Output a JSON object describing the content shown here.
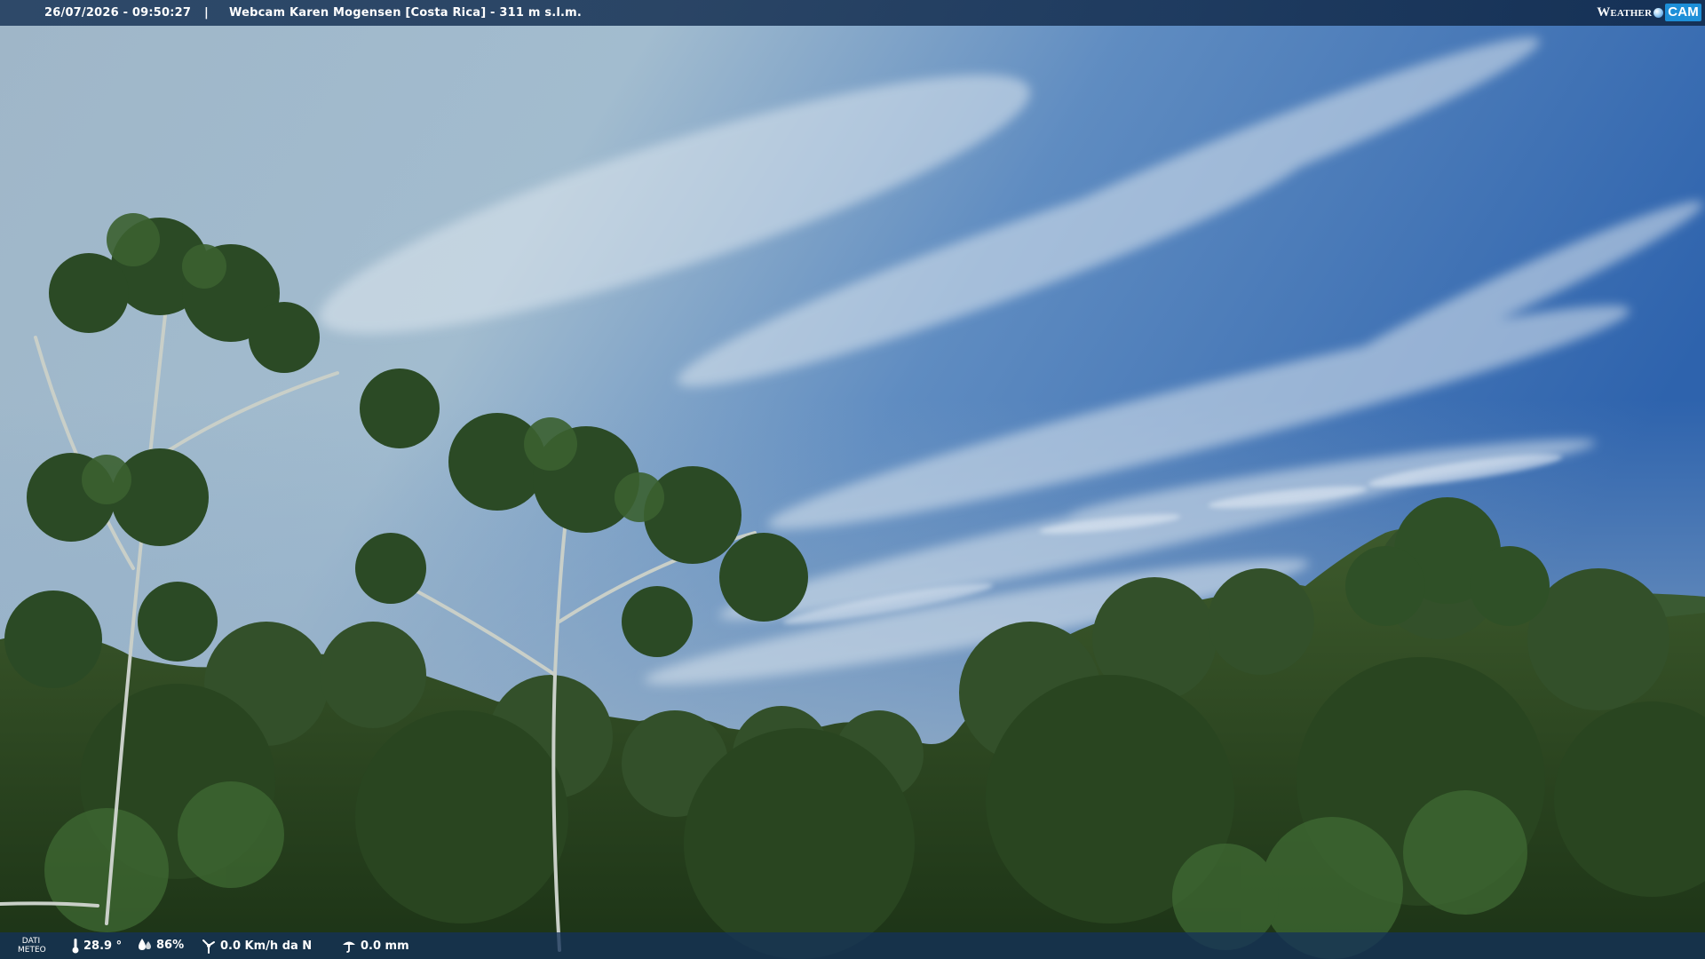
{
  "overlay": {
    "datetime": "26/07/2026 - 09:50:27",
    "separator": "|",
    "title": "Webcam Karen Mogensen [Costa Rica] - 311 m s.l.m.",
    "brand_text": "Weather",
    "brand_cam": "CAM"
  },
  "meteo": {
    "label_line1": "DATI",
    "label_line2": "METEO",
    "temperature": "28.9 °",
    "humidity": "86%",
    "wind": "0.0 Km/h da N",
    "rain": "0.0 mm",
    "icons": [
      "thermometer-icon",
      "humidity-drop-icon",
      "wind-icon",
      "rain-icon"
    ]
  },
  "colors": {
    "bar_background": "#163052",
    "brand_accent": "#1d8fd8",
    "sky_top": "#2f62a6",
    "sky_light": "#a9c0d4",
    "foliage": "#2e4a22"
  }
}
